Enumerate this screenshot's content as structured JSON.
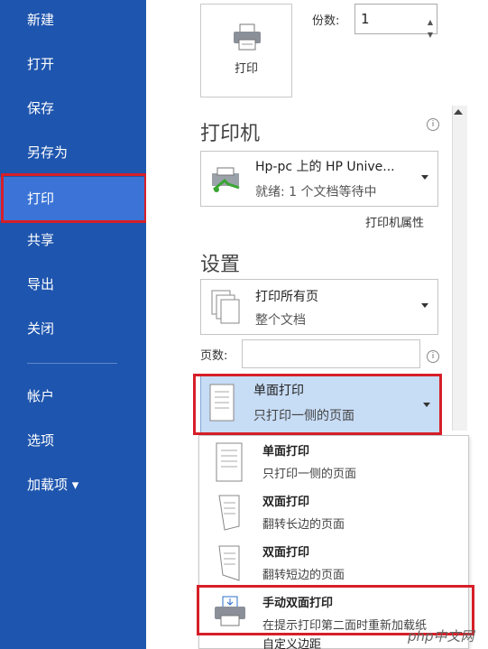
{
  "sidebar": {
    "items": [
      {
        "label": "新建"
      },
      {
        "label": "打开"
      },
      {
        "label": "保存"
      },
      {
        "label": "另存为"
      },
      {
        "label": "打印"
      },
      {
        "label": "共享"
      },
      {
        "label": "导出"
      },
      {
        "label": "关闭"
      },
      {
        "label": "帐户"
      },
      {
        "label": "选项"
      },
      {
        "label": "加载项 ▾"
      }
    ],
    "active_index": 4
  },
  "print_button": {
    "label": "打印"
  },
  "copies": {
    "label": "份数:",
    "value": "1"
  },
  "printer": {
    "heading": "打印机",
    "name": "Hp-pc 上的 HP Unive...",
    "status": "就绪: 1 个文档等待中",
    "properties_link": "打印机属性"
  },
  "settings": {
    "heading": "设置",
    "range_title": "打印所有页",
    "range_subtitle": "整个文档",
    "pages_label": "页数:",
    "pages_value": "",
    "sides_title": "单面打印",
    "sides_subtitle": "只打印一侧的页面"
  },
  "sides_menu": [
    {
      "title": "单面打印",
      "subtitle": "只打印一侧的页面"
    },
    {
      "title": "双面打印",
      "subtitle": "翻转长边的页面"
    },
    {
      "title": "双面打印",
      "subtitle": "翻转短边的页面"
    },
    {
      "title": "手动双面打印",
      "subtitle": "在提示打印第二面时重新加载纸"
    },
    {
      "title": "自定义边距",
      "subtitle": ""
    }
  ],
  "watermark": "php中文网",
  "colors": {
    "sidebar": "#1e55ae",
    "active": "#3b74d6",
    "highlight": "#d61f28"
  }
}
